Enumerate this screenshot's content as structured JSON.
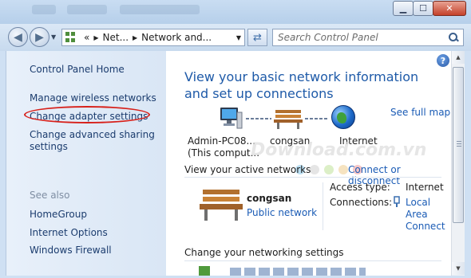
{
  "window": {
    "controls": {
      "minimize": "▁",
      "maximize": "☐",
      "close": "✕"
    }
  },
  "address": {
    "overflow": "«",
    "crumbs": [
      "Net...",
      "Network and..."
    ]
  },
  "search": {
    "placeholder": "Search Control Panel"
  },
  "sidebar": {
    "home": "Control Panel Home",
    "items": [
      "Manage wireless networks",
      "Change adapter settings",
      "Change advanced sharing settings"
    ],
    "see_also_title": "See also",
    "see_also": [
      "HomeGroup",
      "Internet Options",
      "Windows Firewall"
    ]
  },
  "main": {
    "help": "?",
    "title": "View your basic network information and set up connections",
    "see_full_map": "See full map",
    "map_nodes": [
      "Admin-PC08...",
      "(This comput...",
      "congsan",
      "Internet"
    ],
    "watermark": "Download.com.vn",
    "active_networks_title": "View your active networks",
    "connect_link": "Connect or disconnect",
    "network": {
      "name": "congsan",
      "type": "Public network",
      "access_type_label": "Access type:",
      "access_type_value": "Internet",
      "connections_label": "Connections:",
      "connections_value": [
        "Local",
        "Area",
        "Connect"
      ]
    },
    "change_settings_title": "Change your networking settings"
  },
  "colors": {
    "link": "#1a5bb5",
    "title": "#1e5aa8",
    "highlight": "#d7201a",
    "sidebar_bg": "#e3edf8"
  }
}
